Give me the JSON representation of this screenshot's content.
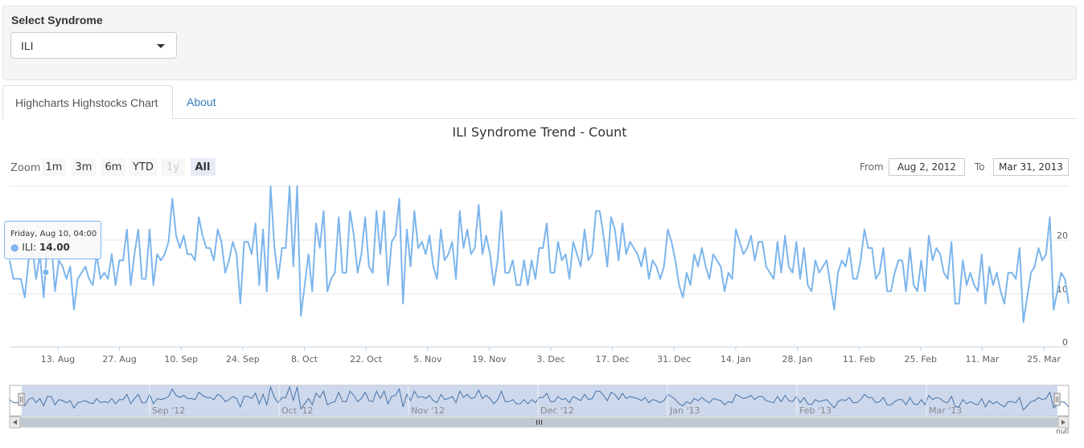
{
  "syndrome_panel": {
    "label": "Select Syndrome",
    "selected": "ILI"
  },
  "tabs": [
    {
      "label": "Highcharts Highstocks Chart",
      "active": true
    },
    {
      "label": "About",
      "active": false
    }
  ],
  "range_selector": {
    "zoom_label": "Zoom",
    "buttons": [
      {
        "label": "1m",
        "state": "normal"
      },
      {
        "label": "3m",
        "state": "normal"
      },
      {
        "label": "6m",
        "state": "normal"
      },
      {
        "label": "YTD",
        "state": "normal"
      },
      {
        "label": "1y",
        "state": "disabled"
      },
      {
        "label": "All",
        "state": "selected"
      }
    ],
    "from_label": "From",
    "from_value": "Aug 2, 2012",
    "to_label": "To",
    "to_value": "Mar 31, 2013"
  },
  "tooltip": {
    "header": "Friday, Aug 10, 04:00",
    "series": "ILI",
    "value": "14.00"
  },
  "navigator": {
    "labels": [
      "Sep '12",
      "Oct '12",
      "Nov '12",
      "Dec '12",
      "Jan '13",
      "Feb '13",
      "Mar '13"
    ],
    "null_label": "null"
  },
  "colors": {
    "series": "#7cb5ec",
    "navigator_fill": "#c8d4ea",
    "navigator_line": "#4572a7",
    "selected_button": "#e6ebf5"
  },
  "chart_data": {
    "type": "line",
    "title": "ILI Syndrome Trend - Count",
    "series": [
      {
        "name": "ILI"
      }
    ],
    "x_ticks": [
      "13. Aug",
      "27. Aug",
      "10. Sep",
      "24. Sep",
      "8. Oct",
      "22. Oct",
      "5. Nov",
      "19. Nov",
      "3. Dec",
      "17. Dec",
      "31. Dec",
      "14. Jan",
      "28. Jan",
      "11. Feb",
      "25. Feb",
      "11. Mar",
      "25. Mar"
    ],
    "y_ticks": [
      "0",
      "10",
      "20"
    ],
    "ylim": [
      0,
      26
    ],
    "x_range": [
      "2012-08-02",
      "2013-03-31"
    ],
    "values": [
      14,
      11,
      11,
      11,
      8,
      14,
      16,
      11,
      15,
      8,
      17,
      17,
      9,
      14,
      13,
      11,
      13,
      6,
      11,
      12,
      13,
      11,
      10,
      15,
      11,
      12,
      11,
      15,
      10,
      14,
      14,
      19,
      10,
      15,
      19,
      11,
      11,
      19,
      10,
      15,
      14,
      15,
      17,
      24,
      18,
      16,
      18,
      15,
      15,
      14,
      21,
      18,
      16,
      16,
      14,
      19,
      17,
      12,
      14,
      17,
      15,
      7,
      17,
      17,
      15,
      20,
      10,
      19,
      9,
      26,
      16,
      11,
      16,
      16,
      26,
      13,
      26,
      5,
      10,
      15,
      9,
      20,
      16,
      22,
      9,
      11,
      12,
      21,
      12,
      12,
      22,
      18,
      12,
      15,
      21,
      13,
      12,
      22,
      15,
      22,
      10,
      17,
      18,
      24,
      7,
      19,
      13,
      22,
      16,
      17,
      15,
      18,
      13,
      11,
      19,
      14,
      15,
      17,
      11,
      22,
      16,
      19,
      15,
      16,
      23,
      15,
      18,
      15,
      10,
      14,
      22,
      12,
      12,
      14,
      10,
      10,
      14,
      10,
      14,
      11,
      16,
      16,
      20,
      12,
      12,
      17,
      14,
      15,
      11,
      17,
      15,
      13,
      19,
      14,
      15,
      22,
      22,
      18,
      13,
      21,
      19,
      14,
      20,
      15,
      17,
      16,
      15,
      13,
      16,
      11,
      14,
      13,
      11,
      13,
      19,
      17,
      14,
      10,
      8,
      12,
      10,
      15,
      13,
      16,
      13,
      11,
      15,
      14,
      13,
      9,
      12,
      11,
      19,
      17,
      15,
      16,
      18,
      14,
      17,
      17,
      13,
      12,
      11,
      17,
      12,
      18,
      13,
      12,
      17,
      11,
      16,
      10,
      9,
      14,
      12,
      13,
      14,
      10,
      6,
      12,
      14,
      13,
      16,
      11,
      11,
      14,
      19,
      16,
      16,
      11,
      12,
      16,
      9,
      9,
      12,
      14,
      14,
      9,
      16,
      10,
      9,
      14,
      9,
      18,
      14,
      16,
      15,
      12,
      11,
      17,
      7,
      7,
      14,
      10,
      12,
      10,
      9,
      15,
      7,
      13,
      10,
      12,
      9,
      7,
      12,
      12,
      11,
      16,
      4,
      8,
      12,
      13,
      16,
      14,
      15,
      21,
      6,
      9,
      12,
      11,
      7
    ]
  }
}
